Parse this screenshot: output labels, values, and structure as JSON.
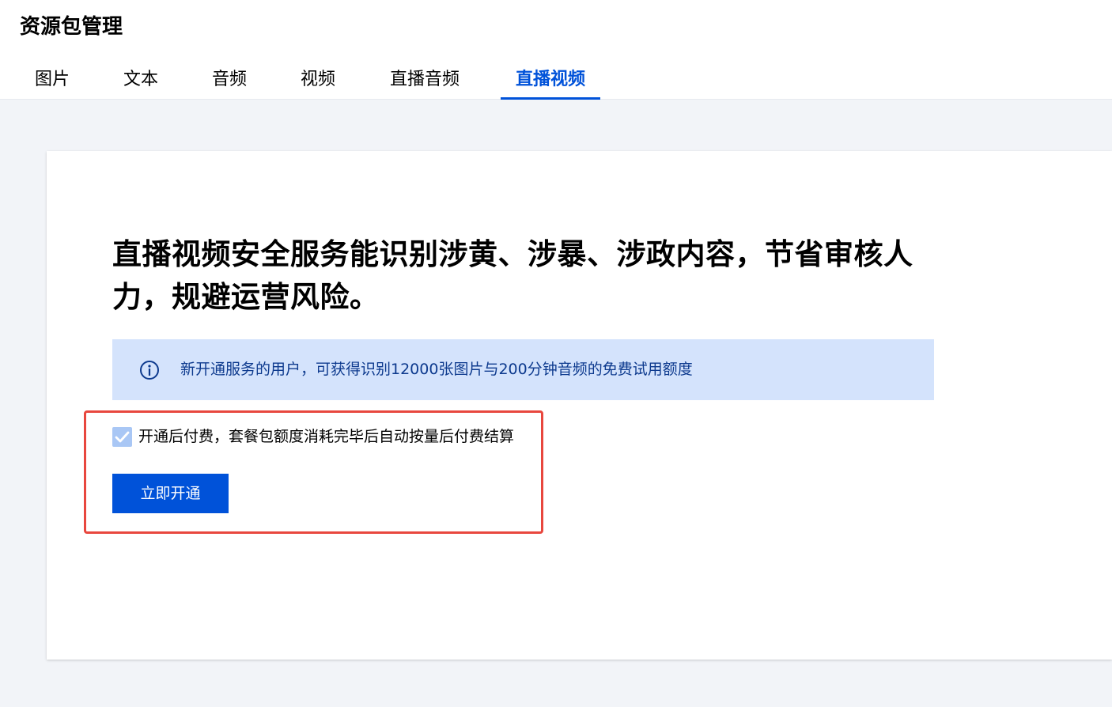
{
  "header": {
    "title": "资源包管理"
  },
  "tabs": [
    {
      "label": "图片",
      "active": false
    },
    {
      "label": "文本",
      "active": false
    },
    {
      "label": "音频",
      "active": false
    },
    {
      "label": "视频",
      "active": false
    },
    {
      "label": "直播音频",
      "active": false
    },
    {
      "label": "直播视频",
      "active": true
    }
  ],
  "main": {
    "headline": "直播视频安全服务能识别涉黄、涉暴、涉政内容，节省审核人力，规避运营风险。",
    "notice": {
      "icon": "info-icon",
      "text": "新开通服务的用户，可获得识别12000张图片与200分钟音频的免费试用额度"
    },
    "postpay": {
      "checked": true,
      "label": "开通后付费，套餐包额度消耗完毕后自动按量后付费结算"
    },
    "activate_button": "立即开通"
  },
  "colors": {
    "accent": "#0052d9",
    "notice_bg": "#d4e3fc",
    "notice_text": "#0d3a8e",
    "highlight_border": "#e8473e",
    "page_bg": "#f2f4f8"
  }
}
